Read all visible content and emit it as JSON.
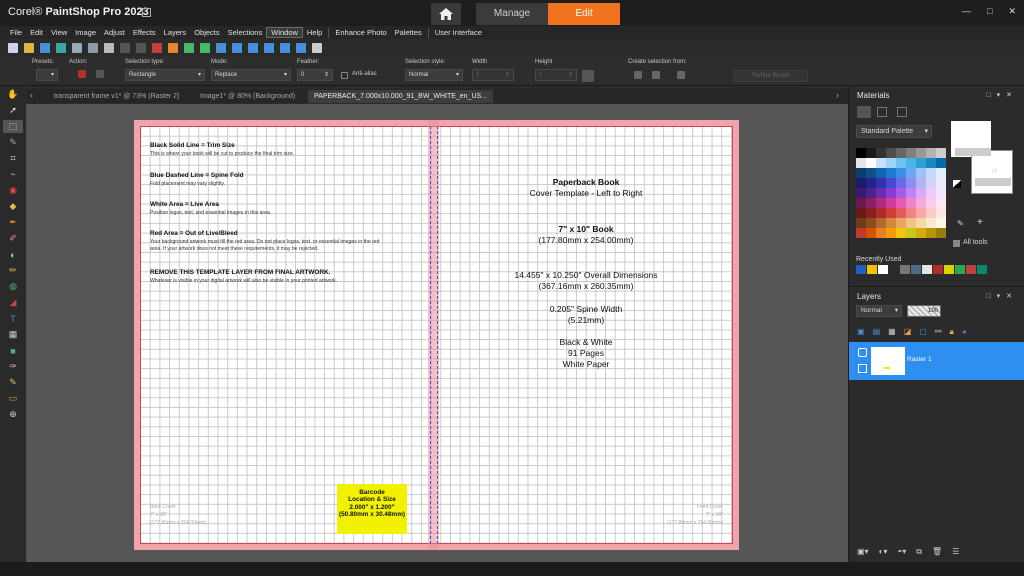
{
  "app": {
    "brand": "Corel",
    "title": "PaintShop Pro 2023"
  },
  "workspace_tabs": {
    "manage": "Manage",
    "edit": "Edit"
  },
  "window_controls": {
    "minimize": "—",
    "restore": "□",
    "close": "✕"
  },
  "menu": [
    "File",
    "Edit",
    "View",
    "Image",
    "Adjust",
    "Effects",
    "Layers",
    "Objects",
    "Selections",
    "Window",
    "Help",
    "Enhance Photo",
    "Palettes",
    "User Interface"
  ],
  "tool_options": {
    "presets_label": "Presets:",
    "action_label": "Action:",
    "selection_type_label": "Selection type:",
    "selection_type_value": "Rectangle",
    "mode_label": "Mode:",
    "mode_value": "Replace",
    "feather_label": "Feather:",
    "feather_value": "0",
    "antialias_label": "Anti-alias",
    "selection_style_label": "Selection style:",
    "selection_style_value": "Normal",
    "width_label": "Width",
    "width_value": "1",
    "height_label": "Height",
    "height_value": "1",
    "create_selection_label": "Create selection from:",
    "refine_brush": "Refine Brush"
  },
  "document_tabs": [
    {
      "label": "transparent frame v1* @  73% (Raster 2)"
    },
    {
      "label": "Image1* @  80% (Background)"
    },
    {
      "label": "PAPERBACK_7.000x10.000_91_BW_WHITE_en_US..."
    }
  ],
  "template": {
    "trim_title": "Black Solid Line = Trim Size",
    "trim_desc": "This is where your book will be cut to produce the final trim size.",
    "spine_title": "Blue Dashed Line = Spine Fold",
    "spine_desc": "Fold placement may vary slightly.",
    "live_title": "White Area = Live Area",
    "live_desc": "Position logos, text, and essential images in this area.",
    "bleed_title": "Red Area = Out of Live/Bleed",
    "bleed_desc_1": "Your background artwork must fill the red area. Do not place logos, text, or essential images in the red",
    "bleed_desc_2": "area. If your artwork does not meet these requirements, it may be rejected.",
    "remove_title": "REMOVE THIS TEMPLATE LAYER FROM FINAL ARTWORK.",
    "remove_desc": "Whatever is visible in your digital artwork will also be visible in your printed artwork.",
    "book_title": "Paperback Book",
    "book_subtitle": "Cover Template - Left to Right",
    "trim_size": "7\" x 10\" Book",
    "trim_size_mm": "(177.80mm x 254.00mm)",
    "overall": "14.455\" x 10.250\" Overall Dimensions",
    "overall_mm": "(367.16mm x 260.35mm)",
    "spine_width": "0.205\" Spine Width",
    "spine_width_mm": "(5.21mm)",
    "ink": "Black & White",
    "pages": "91 Pages",
    "paper": "White Paper",
    "barcode_1": "Barcode",
    "barcode_2": "Location & Size",
    "barcode_3": "2.000\" x 1.200\"",
    "barcode_4": "(50.80mm x 30.48mm)",
    "back_cover_1": "Back Cover",
    "back_cover_2": "7\" x 10\"",
    "back_cover_3": "(177.80mm x 254.00mm)",
    "front_cover_1": "Front Cover",
    "front_cover_2": "7\" x 10\"",
    "front_cover_3": "(177.80mm x 254.00mm)"
  },
  "materials": {
    "title": "Materials",
    "palette": "Standard Palette",
    "all_tools": "All tools",
    "recently_used": "Recently Used",
    "swatches": [
      "#000000",
      "#1a1a1a",
      "#333333",
      "#4d4d4d",
      "#666666",
      "#808080",
      "#999999",
      "#b3b3b3",
      "#cccccc",
      "#e6e6e6",
      "#ffffff",
      "#c6e2ff",
      "#9fd3f7",
      "#6ec1f0",
      "#47b5e6",
      "#2f9fd6",
      "#1b86c2",
      "#0a6aa8",
      "#0b3d6b",
      "#0f4f8a",
      "#1464b0",
      "#1f78d1",
      "#3d8ee6",
      "#6aa8f0",
      "#9cc4f7",
      "#c4dcfb",
      "#e2eefd",
      "#1b1a6b",
      "#24238a",
      "#3331b0",
      "#4a48d1",
      "#6b69e6",
      "#8f8df0",
      "#b3b2f7",
      "#d4d3fb",
      "#eceafd",
      "#3d1a6b",
      "#4f218a",
      "#6a2cb0",
      "#8a3cd1",
      "#a85be6",
      "#c283f0",
      "#d8a9f7",
      "#e9ccfb",
      "#f5e6fd",
      "#6b1a4d",
      "#8a2163",
      "#b02c7e",
      "#d13c9a",
      "#e65bb3",
      "#f083c8",
      "#f7a9da",
      "#fbccea",
      "#fde6f4",
      "#6b1a1a",
      "#8a2121",
      "#b02c2c",
      "#d13c3c",
      "#e65b5b",
      "#f08383",
      "#f7a9a9",
      "#fbcccc",
      "#fde6e6",
      "#6b3d1a",
      "#8a4f21",
      "#b06a2c",
      "#d18a3c",
      "#e6a85b",
      "#f0c283",
      "#f7d8a9",
      "#fbe9cc",
      "#fdf5e6",
      "#c0392b",
      "#d35400",
      "#e67e22",
      "#f39c12",
      "#f1c40f",
      "#c8c81a",
      "#d4ac0d",
      "#b7950b",
      "#9a7d0a"
    ],
    "recent": [
      "#1f5fbf",
      "#f2c200",
      "#ffffff",
      "#2a2a2a",
      "#777777",
      "#4a6b8a",
      "#e5e5e5",
      "#b02c2c",
      "#d4d400",
      "#2fa84f",
      "#c04040",
      "#0a8a6a"
    ]
  },
  "layers": {
    "title": "Layers",
    "blend_mode": "Normal",
    "opacity": "100",
    "layer_name": "Raster 1"
  }
}
